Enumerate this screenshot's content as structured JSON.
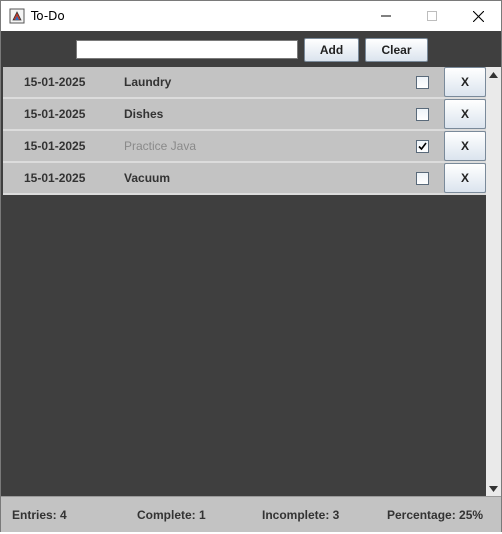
{
  "window": {
    "title": "To-Do"
  },
  "toolbar": {
    "input_value": "",
    "add_label": "Add",
    "clear_label": "Clear"
  },
  "tasks": [
    {
      "date": "15-01-2025",
      "name": "Laundry",
      "done": false,
      "delete_label": "X"
    },
    {
      "date": "15-01-2025",
      "name": "Dishes",
      "done": false,
      "delete_label": "X"
    },
    {
      "date": "15-01-2025",
      "name": "Practice Java",
      "done": true,
      "delete_label": "X"
    },
    {
      "date": "15-01-2025",
      "name": "Vacuum",
      "done": false,
      "delete_label": "X"
    }
  ],
  "status": {
    "entries": "Entries: 4",
    "complete": "Complete: 1",
    "incomplete": "Incomplete: 3",
    "percentage": "Percentage: 25%"
  },
  "colors": {
    "background": "#3f3f3f",
    "row": "#c3c3c3",
    "done_text": "#8a8a8a"
  }
}
